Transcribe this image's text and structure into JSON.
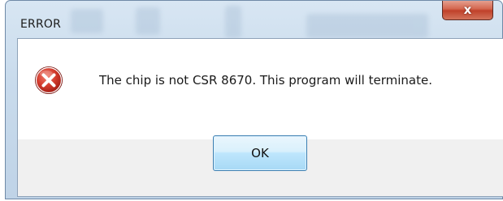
{
  "dialog": {
    "title": "ERROR",
    "close_glyph": "x",
    "icon": "error-icon",
    "message": "The chip is not CSR 8670. This program will terminate.",
    "ok_label": "OK"
  },
  "colors": {
    "frame": "#c9dbec",
    "close_button": "#c8462e",
    "error_icon": "#c62c2c",
    "button_bar": "#f0f0f0",
    "ok_border": "#3c7fb1"
  }
}
